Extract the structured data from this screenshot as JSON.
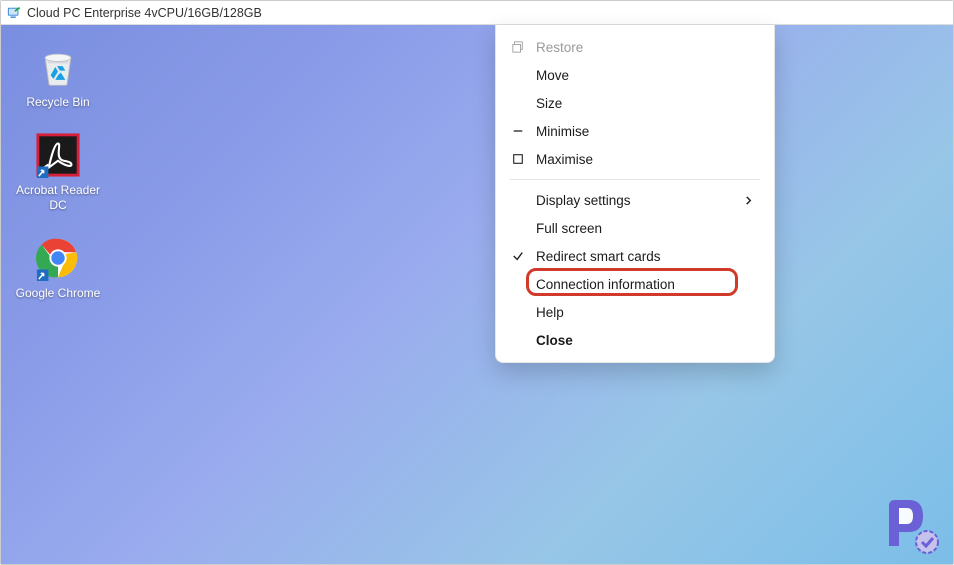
{
  "titlebar": {
    "text": "Cloud PC Enterprise 4vCPU/16GB/128GB"
  },
  "desktop": {
    "icons": [
      {
        "id": "recycle-bin",
        "label": "Recycle Bin"
      },
      {
        "id": "acrobat",
        "label": "Acrobat Reader DC"
      },
      {
        "id": "chrome",
        "label": "Google Chrome"
      }
    ]
  },
  "menu": {
    "items": [
      {
        "label": "Restore",
        "enabled": false,
        "icon": "restore"
      },
      {
        "label": "Move",
        "enabled": true
      },
      {
        "label": "Size",
        "enabled": true
      },
      {
        "label": "Minimise",
        "enabled": true,
        "icon": "minimise"
      },
      {
        "label": "Maximise",
        "enabled": true,
        "icon": "maximise"
      },
      {
        "label": "Display settings",
        "enabled": true,
        "submenu": true
      },
      {
        "label": "Full screen",
        "enabled": true
      },
      {
        "label": "Redirect smart cards",
        "enabled": true,
        "checked": true
      },
      {
        "label": "Connection information",
        "enabled": true,
        "highlighted": true
      },
      {
        "label": "Help",
        "enabled": true
      },
      {
        "label": "Close",
        "enabled": true,
        "bold": true
      }
    ]
  },
  "annotation": {
    "highlight_color": "#d13a2a",
    "target": "Connection information"
  }
}
